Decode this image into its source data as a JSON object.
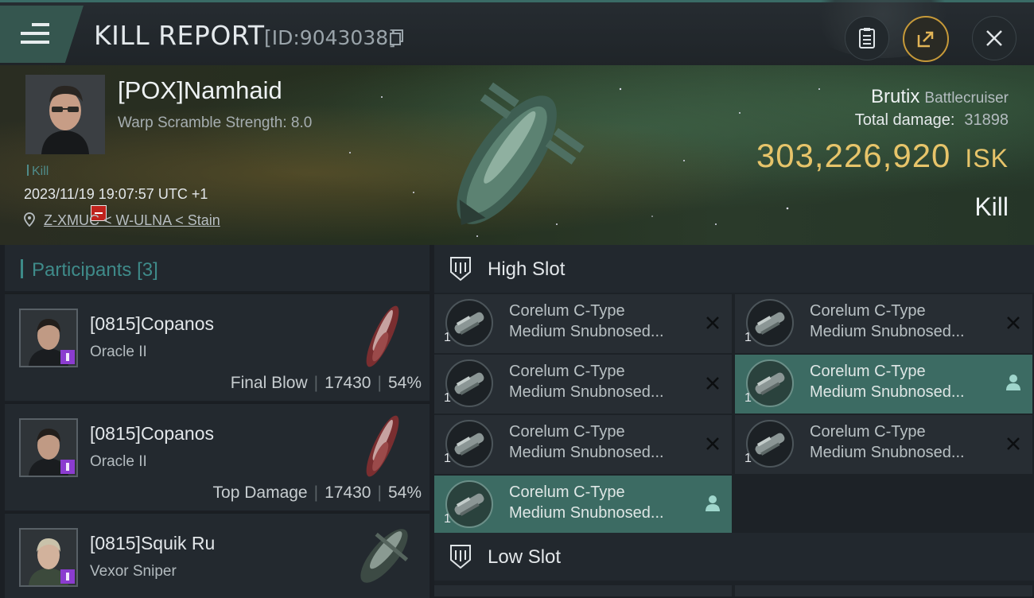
{
  "header": {
    "title": "KILL REPORT",
    "report_id": "[ID:9043038]",
    "icons": [
      "menu-icon",
      "copy-icon",
      "clipboard-icon",
      "share-icon",
      "close-icon"
    ]
  },
  "victim": {
    "name": "[POX]Namhaid",
    "warp_scramble": "Warp Scramble Strength: 8.0",
    "kill_tag": "Kill",
    "datetime": "2023/11/19 19:07:57 UTC +1",
    "location": "Z-XMUC < W-ULNA < Stain",
    "ship_name": "Brutix",
    "ship_class": "Battlecruiser",
    "total_damage_label": "Total damage:",
    "total_damage": "31898",
    "isk_value": "303,226,920",
    "isk_unit": "ISK",
    "result": "Kill"
  },
  "participants": {
    "label": "Participants",
    "count": "[3]",
    "rows": [
      {
        "name": "[0815]Copanos",
        "ship": "Oracle II",
        "role": "Final Blow",
        "damage": "17430",
        "percent": "54%"
      },
      {
        "name": "[0815]Copanos",
        "ship": "Oracle II",
        "role": "Top Damage",
        "damage": "17430",
        "percent": "54%"
      },
      {
        "name": "[0815]Squik Ru",
        "ship": "Vexor Sniper",
        "role": "",
        "damage": "",
        "percent": ""
      }
    ]
  },
  "slots": {
    "high_label": "High Slot",
    "low_label": "Low Slot",
    "high_modules": [
      {
        "line1": "Corelum C-Type",
        "line2": "Medium Snubnosed...",
        "qty": "1",
        "status": "destroyed"
      },
      {
        "line1": "Corelum C-Type",
        "line2": "Medium Snubnosed...",
        "qty": "1",
        "status": "destroyed"
      },
      {
        "line1": "Corelum C-Type",
        "line2": "Medium Snubnosed...",
        "qty": "1",
        "status": "destroyed"
      },
      {
        "line1": "Corelum C-Type",
        "line2": "Medium Snubnosed...",
        "qty": "1",
        "status": "dropped"
      },
      {
        "line1": "Corelum C-Type",
        "line2": "Medium Snubnosed...",
        "qty": "1",
        "status": "destroyed"
      },
      {
        "line1": "Corelum C-Type",
        "line2": "Medium Snubnosed...",
        "qty": "1",
        "status": "destroyed"
      },
      {
        "line1": "Corelum C-Type",
        "line2": "Medium Snubnosed...",
        "qty": "1",
        "status": "dropped"
      }
    ]
  },
  "colors": {
    "accent_teal": "#3d8a88",
    "isk_gold": "#e7c46a",
    "dropped_bg": "#3c6b63",
    "corp_badge": "#8b3ccf",
    "alert_red": "#c0221c"
  }
}
